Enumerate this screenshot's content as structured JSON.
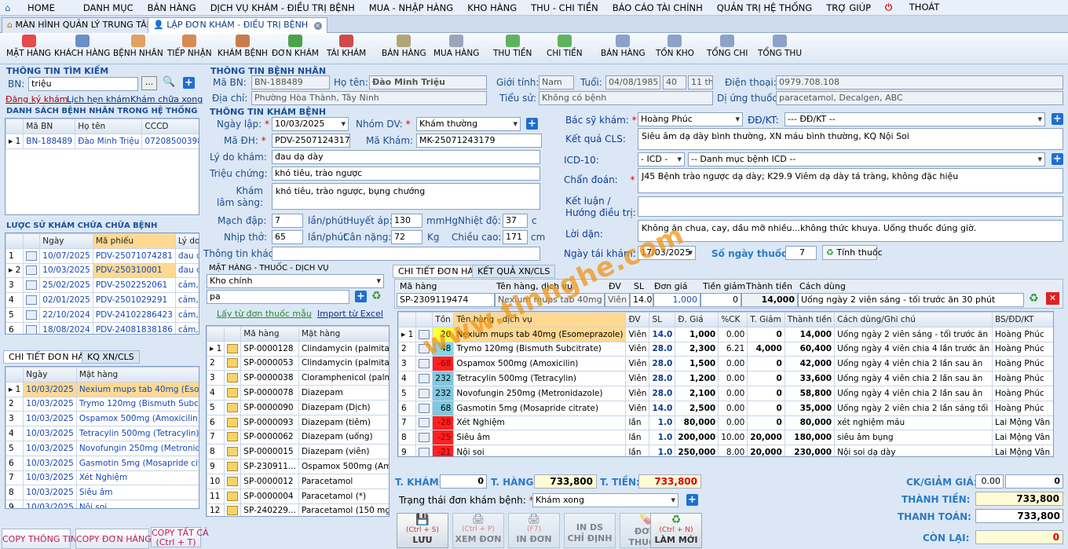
{
  "menu": [
    "HOME",
    "DANH MỤC",
    "BÁN HÀNG",
    "DỊCH VỤ KHÁM - ĐIỀU TRỊ BỆNH",
    "MUA - NHẬP HÀNG",
    "KHO HÀNG",
    "THU - CHI TIỀN",
    "BÁO CÁO TÀI CHÍNH",
    "QUẢN TRỊ HỆ THỐNG",
    "TRỢ GIÚP",
    "THOÁT"
  ],
  "tabs": [
    "MÀN HÌNH QUẢN LÝ TRUNG TÂM",
    "LẬP ĐƠN KHÁM - ĐIỀU TRỊ BỆNH"
  ],
  "toolbar": [
    "MẶT HÀNG",
    "KHÁCH HÀNG",
    "BỆNH NHÂN",
    "TIẾP NHẬN",
    "KHÁM BỆNH",
    "ĐƠN KHÁM",
    "TÁI KHÁM",
    "BÁN HÀNG",
    "MUA HÀNG",
    "THU TIỀN",
    "CHI TIỀN",
    "BÁN HÀNG",
    "TỒN KHO",
    "TỔNG CHI",
    "TỔNG THU"
  ],
  "search": {
    "title": "THÔNG TIN TÌM KIẾM",
    "bn_label": "BN:",
    "bn_value": "triệu",
    "links": [
      "Đăng ký khám",
      "Lịch hẹn khám",
      "Khám chữa xong"
    ],
    "list_title": "DANH SÁCH BỆNH NHÂN TRONG HỆ THỐNG",
    "headers": [
      "Mã BN",
      "Họ tên",
      "CCCD"
    ],
    "rows": [
      [
        "1",
        "BN-188489",
        "Đào Minh Triệu",
        "072085003985"
      ]
    ]
  },
  "history": {
    "title": "LƯỢC SỬ KHÁM CHỮA CHỮA BỆNH",
    "headers": [
      "Ngày",
      "Mã phiếu",
      "Lý do"
    ],
    "rows": [
      [
        "1",
        "10/07/2025",
        "PDV-25071074281",
        "đau đ"
      ],
      [
        "2",
        "10/03/2025",
        "PDV-25031000​1",
        "đau d"
      ],
      [
        "3",
        "25/02/2025",
        "PDV-2502252061",
        "cảm, r"
      ],
      [
        "4",
        "02/01/2025",
        "PDV-2501029291",
        "cảm, r"
      ],
      [
        "5",
        "22/10/2024",
        "PDV-24102286423",
        "cảm, r"
      ],
      [
        "6",
        "18/08/2024",
        "PDV-24081838186",
        "cảm, r"
      ]
    ]
  },
  "ctdon": {
    "tabs": [
      "CHI TIẾT ĐƠN HÀNG",
      "KQ XN/CLS"
    ],
    "headers": [
      "Ngày",
      "Mặt hàng"
    ],
    "rows": [
      [
        "1",
        "10/03/2025",
        "Nexium mups tab 40mg (Esomep"
      ],
      [
        "2",
        "10/03/2025",
        "Trymo 120mg (Bismuth Subcitrat"
      ],
      [
        "3",
        "10/03/2025",
        "Ospamox 500mg (Amoxicilin)"
      ],
      [
        "4",
        "10/03/2025",
        "Tetracylin 500mg (Tetracylin)"
      ],
      [
        "5",
        "10/03/2025",
        "Novofungin 250mg (Metronidazol"
      ],
      [
        "6",
        "10/03/2025",
        "Gasmotin 5mg (Mosapride citrate"
      ],
      [
        "7",
        "10/03/2025",
        "Xét Nghiệm"
      ],
      [
        "8",
        "10/03/2025",
        "Siêu âm"
      ],
      [
        "9",
        "10/03/2025",
        "Nội soi"
      ]
    ]
  },
  "leftbtns": [
    "COPY THÔNG TIN",
    "COPY ĐƠN HÀNG",
    "COPY TẤT CẢ",
    "(Ctrl + T)"
  ],
  "patient": {
    "title": "THÔNG TIN BỆNH NHÂN",
    "ma_bn_l": "Mã BN:",
    "ma_bn": "BN-188489",
    "hoten_l": "Họ tên:",
    "hoten": "Đào Minh Triệu",
    "gt_l": "Giới tính:",
    "gt": "Nam",
    "tuoi_l": "Tuổi:",
    "ngaysinh": "04/08/1985",
    "tuoi": "40",
    "thang": "11 th",
    "dt_l": "Điện thoại:",
    "dt": "0979.708.108",
    "dc_l": "Địa chỉ:",
    "dc": "Phường Hòa Thành, Tây Ninh",
    "ts_l": "Tiểu sử:",
    "ts": "Không có bệnh",
    "du_l": "Dị ứng thuốc:",
    "du": "paracetamol, Decalgen, ABC"
  },
  "kham": {
    "title": "THÔNG TIN KHÁM BỆNH",
    "ngay_l": "Ngày lập:",
    "ngay": "10/03/2025",
    "nhom_l": "Nhóm DV:",
    "nhom": "Khám thường",
    "madh_l": "Mã ĐH:",
    "madh": "PDV-25071243179",
    "mak_l": "Mã Khám:",
    "mak": "MK-25071243179",
    "lydo_l": "Lý do khám:",
    "lydo": "đau dạ dày",
    "tc_l": "Triệu chứng:",
    "tc": "khó tiêu, trào ngược",
    "kls_l": "Khám lâm sàng:",
    "kls": "khó tiêu, trào ngược, bụng chướng",
    "mach_l": "Mạch đập:",
    "mach": "7",
    "mach_u": "lần/phút",
    "ha_l": "Huyết áp:",
    "ha": "130",
    "ha_u": "mmHg",
    "nd_l": "Nhiệt độ:",
    "nd": "37",
    "nd_u": "c",
    "nt_l": "Nhịp thở:",
    "nt": "65",
    "nt_u": "lần/phút",
    "cn_l": "Cân nặng:",
    "cn": "72",
    "cn_u": "Kg",
    "cc_l": "Chiều cao:",
    "cc": "171",
    "cc_u": "cm",
    "ttk_l": "Thông tin khác:"
  },
  "right": {
    "bs_l": "Bác sỹ khám:",
    "bs": "Hoàng Phúc",
    "dd_l": "ĐĐ/KT:",
    "dd": "--- ĐĐ/KT --",
    "cls_l": "Kết quả CLS:",
    "cls": "Siêu âm dạ dày bình thường, XN máu bình thường, KQ Nội Soi",
    "icd_l": "ICD-10:",
    "icd": "- ICD -",
    "icdcat": "-- Danh mục bệnh ICD --",
    "cd_l": "Chẩn đoán:",
    "cd": "J45 Bệnh trào ngược dạ dày; K29.9 Viêm dạ dày tá tràng, không đặc hiệu",
    "kl_l1": "Kết luận /",
    "kl_l2": "Hướng điều trị:",
    "ld_l": "Lời dặn:",
    "ld": "Không ăn chua, cay, dầu mỡ nhiều...không thức khuya. Uống thuốc đúng giờ.",
    "tk_l": "Ngày tái khám:",
    "tk": "17/03/2025",
    "snt_l": "Số ngày thuốc:",
    "snt": "7",
    "tinh": "Tính thuốc"
  },
  "mh": {
    "title": "MẶT HÀNG - THUỐC - DỊCH VỤ",
    "kho": "Kho chính",
    "search": "pa",
    "link1": "Lấy từ đơn thuốc mẫu",
    "link2": "Import từ Excel",
    "headers": [
      "Mã hàng",
      "Mặt hàng"
    ],
    "rows": [
      [
        "1",
        "SP-0000128",
        "Clindamycin (palmitat) dung dị"
      ],
      [
        "2",
        "SP-0000053",
        "Clindamycin (palmitat) viên"
      ],
      [
        "3",
        "SP-0000038",
        "Cloramphenicol (palmitat) viên"
      ],
      [
        "4",
        "SP-0000078",
        "Diazepam"
      ],
      [
        "5",
        "SP-0000090",
        "Diazepam (Dịch)"
      ],
      [
        "6",
        "SP-0000093",
        "Diazepam (tiêm)"
      ],
      [
        "7",
        "SP-0000062",
        "Diazepam (uống)"
      ],
      [
        "8",
        "SP-0000015",
        "Diazepam (viên)"
      ],
      [
        "9",
        "SP-230911...",
        "Ospamox 500mg (Amoxicilin)"
      ],
      [
        "10",
        "SP-0000012",
        "Paracetamol"
      ],
      [
        "11",
        "SP-0000004",
        "Paracetamol (*)"
      ],
      [
        "12",
        "SP-240229...",
        "Paracetamol (150 mg)"
      ]
    ]
  },
  "dh": {
    "tabs": [
      "CHI TIẾT ĐƠN HÀNG",
      "KẾT QUẢ XN/CLS"
    ],
    "inhdr": [
      "Mã hàng",
      "Tên hàng, dịch vụ",
      "ĐV",
      "SL",
      "Đơn giá",
      "Tiền giảm",
      "Thành tiền",
      "Cách dùng"
    ],
    "in": [
      "SP-2309119474",
      "Nexium mups tab 40mg (Esom",
      "Viên",
      "14.0",
      "1,000",
      "0",
      "14,000",
      "Uống ngày 2 viên sáng - tối trước ăn 30 phút"
    ],
    "headers": [
      "",
      "",
      "Tồn",
      "Tên hàng - dịch vụ",
      "ĐV",
      "SL",
      "Đ. Giá",
      "%CK",
      "T. Giảm",
      "Thành tiền",
      "Cách dùng/Ghi chú",
      "BS/ĐD/KT"
    ],
    "rows": [
      [
        "1",
        "20",
        "Nexium mups tab 40mg (Esomeprazole)",
        "Viên",
        "14.0",
        "1,000",
        "0.00",
        "0",
        "14,000",
        "Uống ngày 2 viên sáng - tối trước ăn",
        "Hoàng Phúc"
      ],
      [
        "2",
        "48",
        "Trymo 120mg (Bismuth Subcitrate)",
        "Viên",
        "28.0",
        "2,300",
        "6.21",
        "4,000",
        "60,400",
        "Uống ngày 4 viên chia 4 lần trước ăn",
        "Hoàng Phúc"
      ],
      [
        "3",
        "-68",
        "Ospamox 500mg (Amoxicilin)",
        "Viên",
        "28.0",
        "1,500",
        "0.00",
        "0",
        "42,000",
        "Uống ngày 4 viên chia 2 lần sau ăn",
        "Hoàng Phúc"
      ],
      [
        "4",
        "232",
        "Tetracylin 500mg (Tetracylin)",
        "Viên",
        "28.0",
        "1,200",
        "0.00",
        "0",
        "33,600",
        "Uống ngày 4 viên chia 2 lần sau ăn",
        "Hoàng Phúc"
      ],
      [
        "5",
        "232",
        "Novofungin 250mg (Metronidazole)",
        "Viên",
        "28.0",
        "2,100",
        "0.00",
        "0",
        "58,800",
        "Uống ngày 4 viên chia 2 lần sau ăn",
        "Hoàng Phúc"
      ],
      [
        "6",
        "68",
        "Gasmotin 5mg (Mosapride citrate)",
        "Viên",
        "14.0",
        "2,500",
        "0.00",
        "0",
        "35,000",
        "Uống ngày 2 viên chia 2 lần sáng tối",
        "Hoàng Phúc"
      ],
      [
        "7",
        "-28",
        "Xét Nghiệm",
        "lần",
        "1.0",
        "80,000",
        "0.00",
        "0",
        "80,000",
        "xét nghiệm máu",
        "Lai Mộng Vân"
      ],
      [
        "8",
        "-25",
        "Siêu âm",
        "lần",
        "1.0",
        "200,000",
        "10.00",
        "20,000",
        "180,000",
        "siêu âm bụng",
        "Lai Mộng Vân"
      ],
      [
        "9",
        "-21",
        "Nội soi",
        "lần",
        "1.0",
        "250,000",
        "8.00",
        "20,000",
        "230,000",
        "Nội soi dạ dày",
        "Lai Mộng Vân"
      ]
    ],
    "tonColors": [
      "#ffff3a",
      "#7fd8e8",
      "#ff2020",
      "#7fc8e0",
      "#7fc8e0",
      "#7fc8e0",
      "#ff2020",
      "#ff2020",
      "#ff2020"
    ]
  },
  "totals": {
    "tk_l": "T. KHÁM:",
    "tk": "0",
    "th_l": "T. HÀNG:",
    "th": "733,800",
    "tt_l": "T. TIỀN:",
    "tt": "733,800",
    "tr_l": "Trạng thái đơn khám bệnh:",
    "tr": "Khám xong",
    "ck_l": "CK/GIẢM GIÁ:",
    "ck1": "0.00",
    "ck2": "0",
    "thanh_l": "THÀNH TIỀN:",
    "thanh": "733,800",
    "toan_l": "THANH TOÁN:",
    "toan": "733,800",
    "con_l": "CÒN LẠI:",
    "con": "0"
  },
  "actions": [
    [
      "(Ctrl + S)",
      "LƯU"
    ],
    [
      "(Ctrl + P)",
      "XEM ĐƠN"
    ],
    [
      "(F7)",
      "IN ĐƠN"
    ],
    [
      "IN DS",
      "CHỈ ĐỊNH"
    ],
    [
      "ĐƠN",
      "THUỐC"
    ],
    [
      "(Ctrl + N)",
      "LÀM MỚI"
    ]
  ],
  "watermark": "www.tinnghe.com"
}
